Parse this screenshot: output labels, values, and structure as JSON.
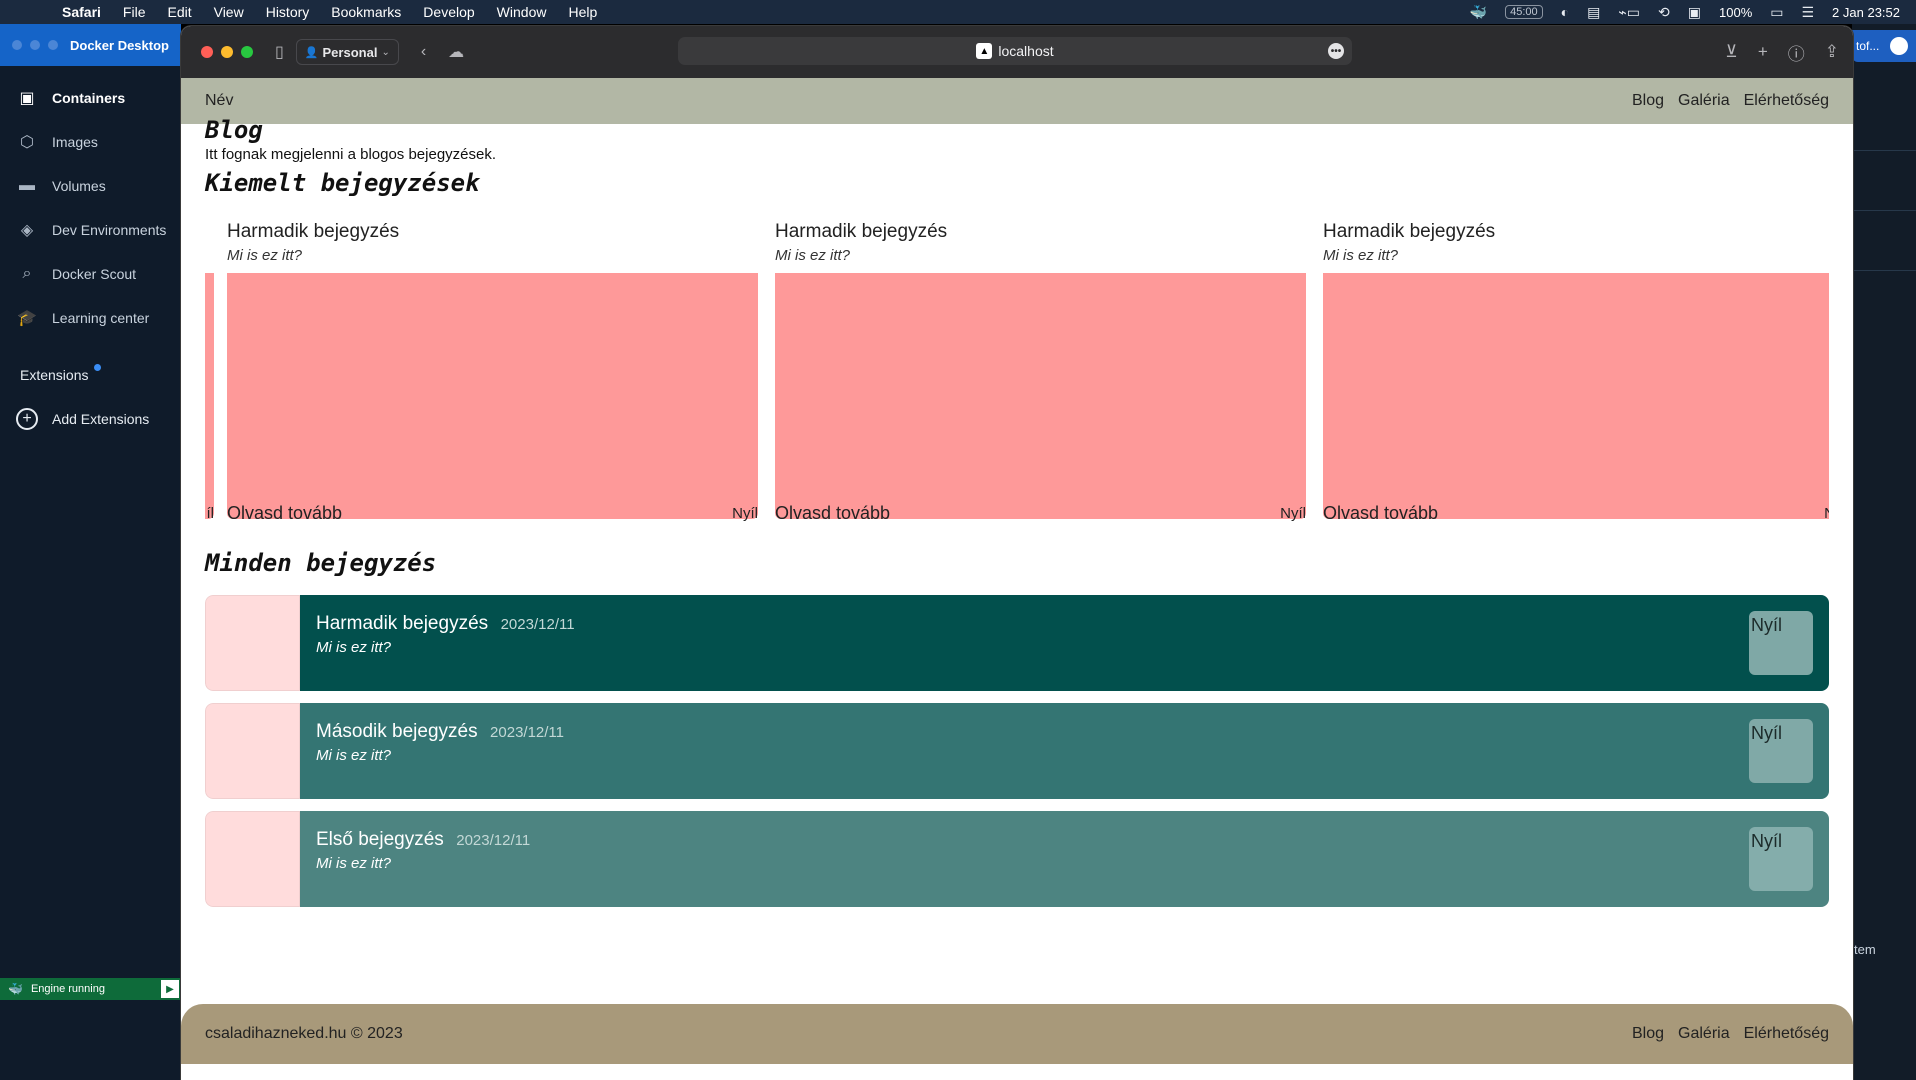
{
  "menubar": {
    "app": "Safari",
    "items": [
      "File",
      "Edit",
      "View",
      "History",
      "Bookmarks",
      "Develop",
      "Window",
      "Help"
    ],
    "timer": "45:00",
    "battery": "100%",
    "datetime": "2 Jan  23:52"
  },
  "docker": {
    "title": "Docker Desktop",
    "nav": [
      {
        "label": "Containers",
        "icon": "containers-icon"
      },
      {
        "label": "Images",
        "icon": "images-icon"
      },
      {
        "label": "Volumes",
        "icon": "volumes-icon"
      },
      {
        "label": "Dev Environments",
        "icon": "dev-environments-icon"
      },
      {
        "label": "Docker Scout",
        "icon": "docker-scout-icon"
      },
      {
        "label": "Learning center",
        "icon": "learning-center-icon"
      }
    ],
    "extensions_label": "Extensions",
    "add_extensions_label": "Add Extensions",
    "engine_status": "Engine running",
    "right_tab_text": "tof...",
    "right_tail_text": "tem"
  },
  "safari": {
    "profile": "Personal",
    "url": "localhost"
  },
  "site": {
    "brand": "Név",
    "nav_links": [
      "Blog",
      "Galéria",
      "Elérhetőség"
    ],
    "blog_title": "Blog",
    "blog_desc": "Itt fognak megjelenni a blogos bejegyzések.",
    "featured_title": "Kiemelt bejegyzések",
    "featured_cards": [
      {
        "title": "Harmadik bejegyzés",
        "subtitle": "Mi is ez itt?",
        "read_more": "Olvasd tovább",
        "arrow": "Nyíl"
      },
      {
        "title": "Harmadik bejegyzés",
        "subtitle": "Mi is ez itt?",
        "read_more": "Olvasd tovább",
        "arrow": "Nyíl"
      },
      {
        "title": "Harmadik bejegyzés",
        "subtitle": "Mi is ez itt?",
        "read_more": "Olvasd tovább",
        "arrow": "Nyíl"
      }
    ],
    "carousel_prev_fragment": "íl",
    "carousel_next_fragment": "N",
    "all_title": "Minden bejegyzés",
    "posts": [
      {
        "title": "Harmadik bejegyzés",
        "date": "2023/12/11",
        "subtitle": "Mi is ez itt?",
        "button": "Nyíl"
      },
      {
        "title": "Második bejegyzés",
        "date": "2023/12/11",
        "subtitle": "Mi is ez itt?",
        "button": "Nyíl"
      },
      {
        "title": "Első bejegyzés",
        "date": "2023/12/11",
        "subtitle": "Mi is ez itt?",
        "button": "Nyíl"
      }
    ],
    "footer_copy": "csaladihazneked.hu © 2023",
    "footer_links": [
      "Blog",
      "Galéria",
      "Elérhetőség"
    ]
  },
  "colors": {
    "featured_image": "#fe9999",
    "post_row_1": "#02504d",
    "post_row_2": "#347573",
    "post_row_3": "#4d8481",
    "nav_bg": "#b2b7a5",
    "footer_bg": "#a8997a"
  }
}
